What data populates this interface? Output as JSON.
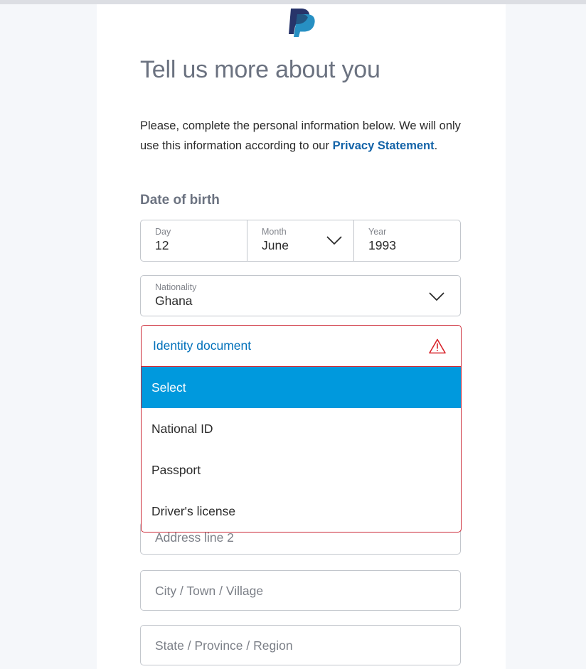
{
  "brand": {
    "logo_icon": "paypal-logo",
    "primary_color": "#0070ba",
    "logo_dark": "#27346a",
    "logo_light": "#2790c3"
  },
  "page": {
    "title": "Tell us more about you",
    "intro_before_link": "Please, complete the personal information below. We will only use this information according to our ",
    "privacy_link_label": "Privacy Statement",
    "intro_after_link": "."
  },
  "sections": {
    "date_of_birth": {
      "heading": "Date of birth",
      "fields": [
        {
          "label": "Day",
          "value": "12",
          "icon": null
        },
        {
          "label": "Month",
          "value": "June",
          "icon": "chevron-down-icon"
        },
        {
          "label": "Year",
          "value": "1993",
          "icon": null
        }
      ]
    },
    "nationality": {
      "label": "Nationality",
      "value": "Ghana",
      "icon": "chevron-down-icon"
    },
    "identity_document": {
      "label": "Identity document",
      "state": "error",
      "error_icon": "warning-triangle-icon",
      "error_color": "#cc2936",
      "label_color": "#0070ba",
      "highlight_color": "#0099dd",
      "expanded": true,
      "options": [
        {
          "label": "Select",
          "selected": true
        },
        {
          "label": "National ID",
          "selected": false
        },
        {
          "label": "Passport",
          "selected": false
        },
        {
          "label": "Driver's license",
          "selected": false
        }
      ]
    },
    "address": {
      "line2_placeholder": "Address line 2",
      "city_placeholder": "City / Town / Village",
      "state_placeholder": "State / Province / Region"
    }
  }
}
